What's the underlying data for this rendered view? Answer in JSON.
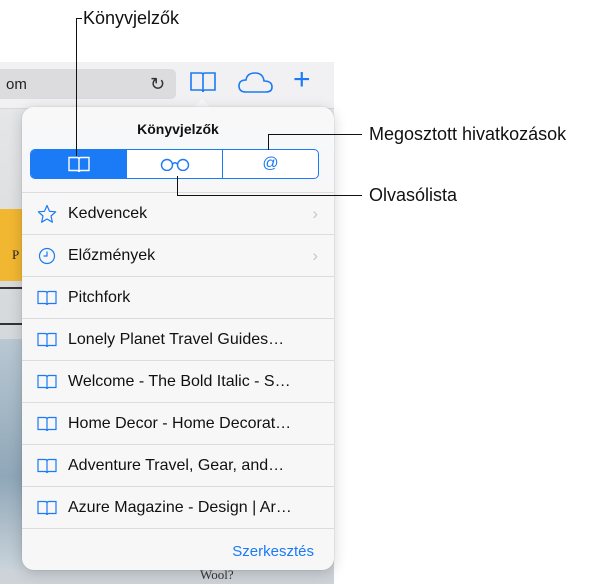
{
  "callouts": {
    "bookmarks": "Könyvjelzők",
    "shared_links": "Megosztott hivatkozások",
    "reading_list": "Olvasólista"
  },
  "browser": {
    "url_text": "om",
    "background_snippet": "Wool?",
    "background_letter": "P"
  },
  "popover": {
    "title": "Könyvjelzők",
    "segments": [
      {
        "icon": "book-icon",
        "selected": true
      },
      {
        "icon": "glasses-icon",
        "selected": false
      },
      {
        "icon": "at-icon",
        "label": "@",
        "selected": false
      }
    ],
    "items": [
      {
        "icon": "star-icon",
        "label": "Kedvencek",
        "chevron": true
      },
      {
        "icon": "clock-icon",
        "label": "Előzmények",
        "chevron": true
      },
      {
        "icon": "book-icon",
        "label": "Pitchfork"
      },
      {
        "icon": "book-icon",
        "label": "Lonely Planet Travel Guides…"
      },
      {
        "icon": "book-icon",
        "label": "Welcome - The Bold Italic - S…"
      },
      {
        "icon": "book-icon",
        "label": "Home Decor - Home Decorat…"
      },
      {
        "icon": "book-icon",
        "label": "Adventure Travel, Gear, and…"
      },
      {
        "icon": "book-icon",
        "label": "Azure Magazine - Design | Ar…"
      }
    ],
    "edit_label": "Szerkesztés"
  },
  "colors": {
    "accent": "#1b7af5"
  }
}
